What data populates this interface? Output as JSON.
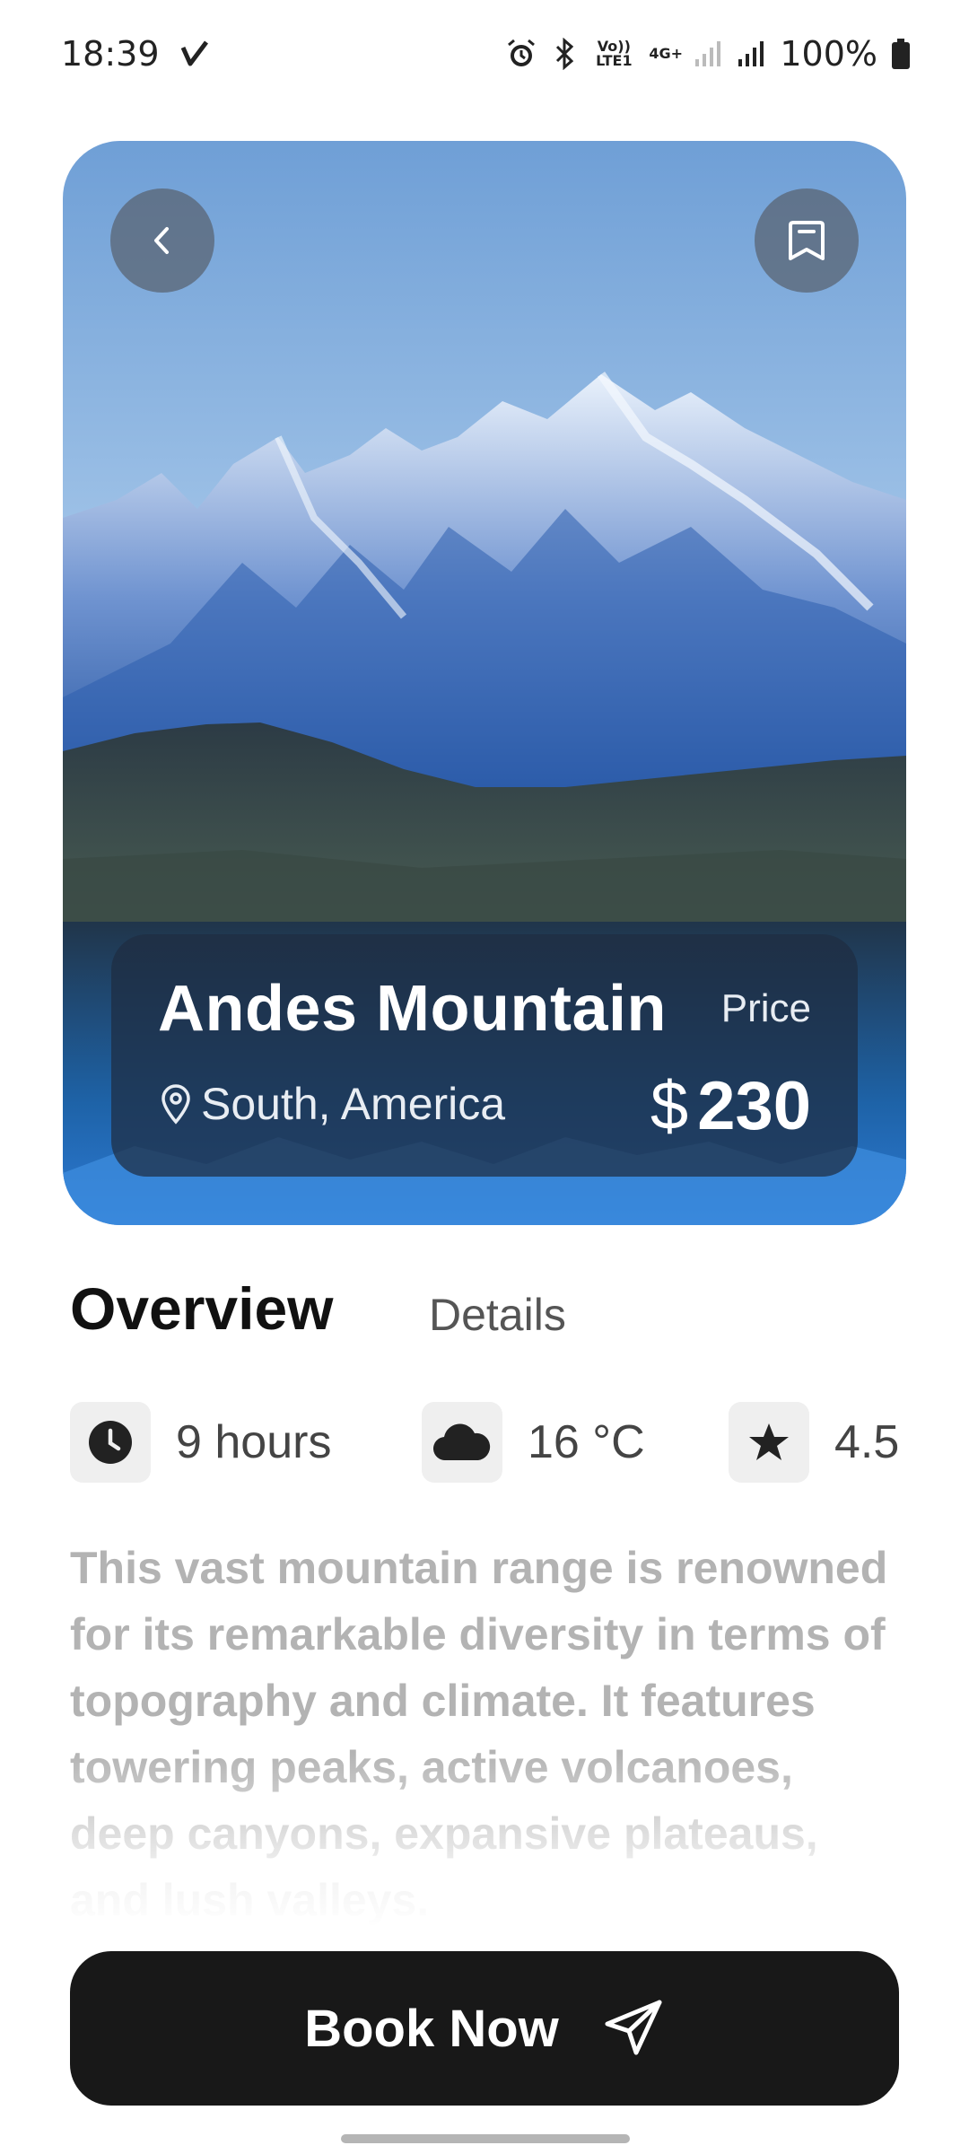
{
  "status_bar": {
    "time": "18:39",
    "battery": "100%",
    "network_label": "Vo)) LTE1",
    "network_label2": "4G+"
  },
  "hero": {
    "back_icon": "chevron-left-icon",
    "bookmark_icon": "bookmark-icon",
    "title": "Andes Mountain",
    "price_label": "Price",
    "location": "South, America",
    "currency": "$",
    "price": "230"
  },
  "tabs": {
    "overview": "Overview",
    "details": "Details"
  },
  "stats": {
    "hours": "9 hours",
    "temperature": "16 °C",
    "rating": "4.5"
  },
  "description": "This vast mountain range is renowned for its remarkable diversity in terms of topography and climate. It features towering peaks, active volcanoes, deep canyons, expansive plateaus, and lush valleys.",
  "book_button": {
    "label": "Book Now",
    "icon": "send-icon"
  },
  "colors": {
    "button_bg": "#181818",
    "panel_bg": "#1e2d41",
    "sky": "#7aa6d8"
  }
}
